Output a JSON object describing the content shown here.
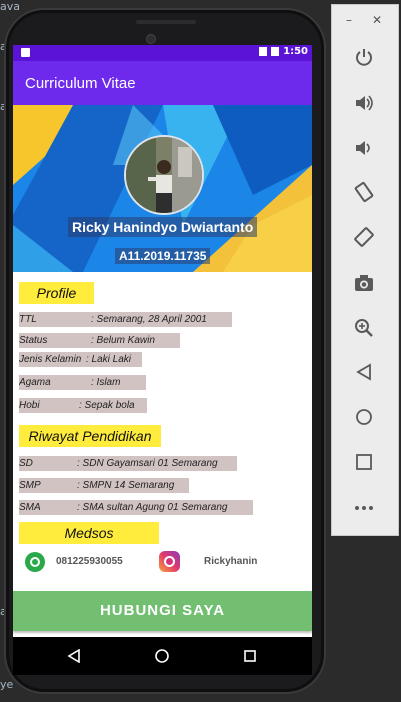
{
  "ide": {
    "fragments": [
      "ava",
      "a",
      "a",
      "a",
      "ye"
    ]
  },
  "status_bar": {
    "time": "1:50"
  },
  "app_bar": {
    "title": "Curriculum Vitae"
  },
  "profile_header": {
    "name": "Ricky Hanindyo Dwiartanto",
    "student_id": "A11.2019.11735"
  },
  "profile": {
    "heading": "Profile",
    "rows": [
      {
        "label": "TTL",
        "value": ": Semarang, 28 April 2001"
      },
      {
        "label": "Status",
        "value": ": Belum Kawin"
      },
      {
        "label": "Jenis Kelamin",
        "value": ": Laki Laki"
      },
      {
        "label": "Agama",
        "value": ": Islam"
      },
      {
        "label": "Hobi",
        "value": ": Sepak bola"
      }
    ]
  },
  "education": {
    "heading": "Riwayat Pendidikan",
    "rows": [
      {
        "label": "SD",
        "value": ": SDN Gayamsari 01 Semarang"
      },
      {
        "label": "SMP",
        "value": ": SMPN 14 Semarang"
      },
      {
        "label": "SMA",
        "value": ": SMA sultan Agung 01 Semarang"
      }
    ]
  },
  "medsos": {
    "heading": "Medsos",
    "whatsapp": "081225930055",
    "instagram": "Rickyhanin"
  },
  "cta": {
    "label": "HUBUNGI SAYA"
  },
  "emulator": {
    "minimize": "–",
    "close": "✕"
  },
  "colors": {
    "appbar": "#6d29ec",
    "status": "#5b13d6",
    "section_bg": "#ffec3d",
    "row_bg": "#d2c3c3",
    "cta": "#73bf72"
  }
}
